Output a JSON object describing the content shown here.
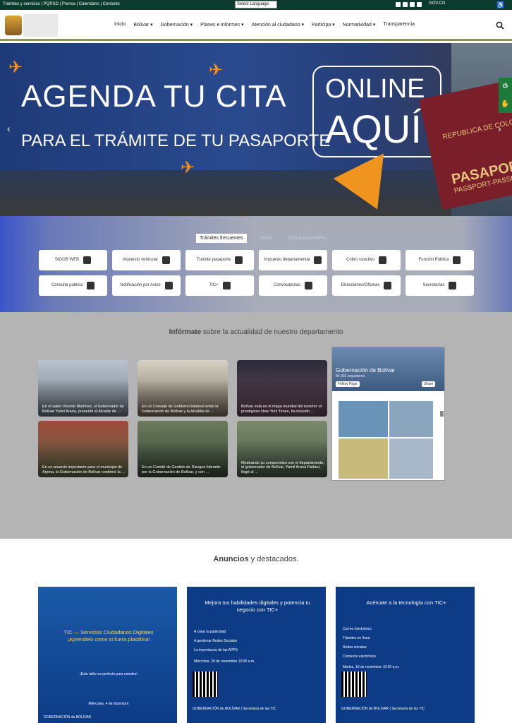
{
  "topbar": {
    "links": "Trámites y servicios | PQRSD | Prensa | Calendario | Contacto",
    "language_select": "Select Language",
    "gov_label": "GOV.CO"
  },
  "header": {
    "nav": [
      "Inicio",
      "Bolívar ▾",
      "Gobernación ▾",
      "Planes e informes ▾",
      "Atención al ciudadano ▾",
      "Participa ▾",
      "Normatividad ▾",
      "Transparencia"
    ]
  },
  "hero": {
    "headline": "AGENDA TU CITA",
    "subheadline": "PARA EL TRÁMITE DE TU PASAPORTE",
    "online": "ONLINE",
    "aqui": "AQUÍ",
    "passport_country": "REPUBLICA DE COLOMBIA",
    "passport_word": "PASAPORTE",
    "passport_sub": "PASSPORT-PASSPORT"
  },
  "tramites": {
    "tabs": [
      "Trámites frecuentes",
      "Sitios",
      "Informacionables"
    ],
    "items": [
      "SIGOB WEB",
      "Impuesto vehicular",
      "Trámite pasaporte",
      "Impuesto departamental",
      "Cobro coactivo",
      "Función Pública",
      "Consulta pública",
      "Notificación por Aviso",
      "TIC+",
      "Convocatorias",
      "Direcciones/Oficinas",
      "Secretarías"
    ]
  },
  "news": {
    "title_bold": "Infórmate",
    "title_rest": " sobre la actualidad de nuestro departamento",
    "items": [
      "En el salón Vicente Martínez, el Gobernador de Bolívar Yamil Arana, presentó al Alcalde de ...",
      "En un Consejo de Gobierno bilateral entre la Gobernación de Bolívar y la Alcaldía de ...",
      "Bolívar está en el mapa mundial del turismo: el prestigioso New York Times, ha incluido ...",
      "En un anuncio importante para el municipio de Arjona, la Gobernación de Bolívar confirmó la ...",
      "En un Comité de Gestión de Riesgos liderado por la Gobernación de Bolívar, y con ...",
      "Mostrando su compromiso con el departamento, el gobernador de Bolívar, Yamil Arana Padauí, llegó al ..."
    ],
    "facebook": {
      "name": "Gobernación de Bolívar",
      "followers": "84.302 seguidores",
      "follow": "Follow Page",
      "share": "Share"
    }
  },
  "anuncios": {
    "title_bold": "Anuncios",
    "title_rest": " y destacados.",
    "cards": [
      {
        "title": "TIC — Servicios Ciudadanos Digitales ¡Aprendelo como si fuera plastilina!",
        "lines": [
          "¡Este taller es perfecto para ustedes!",
          "Miércoles, 4 de diciembre"
        ],
        "footer": "GOBERNACIÓN de BOLÍVAR"
      },
      {
        "title": "Mejora tus habilidades digitales y potencia tu negocio con TIC+",
        "lines": [
          "A crear tu publicidad",
          "A gestionar Redes Sociales",
          "La importancia de las APPS",
          "Miércoles, 20 de noviembre 10:00 a.m."
        ],
        "footer": "GOBERNACIÓN de BOLÍVAR | Secretaría de las TIC"
      },
      {
        "title": "Acércate a la tecnología con TIC+",
        "lines": [
          "Correo electrónico",
          "Trámites en línea",
          "Redes sociales",
          "Comercio electrónico",
          "Martes, 19 de noviembre 10:30 a.m."
        ],
        "footer": "GOBERNACIÓN de BOLÍVAR | Secretaría de las TIC"
      }
    ]
  }
}
